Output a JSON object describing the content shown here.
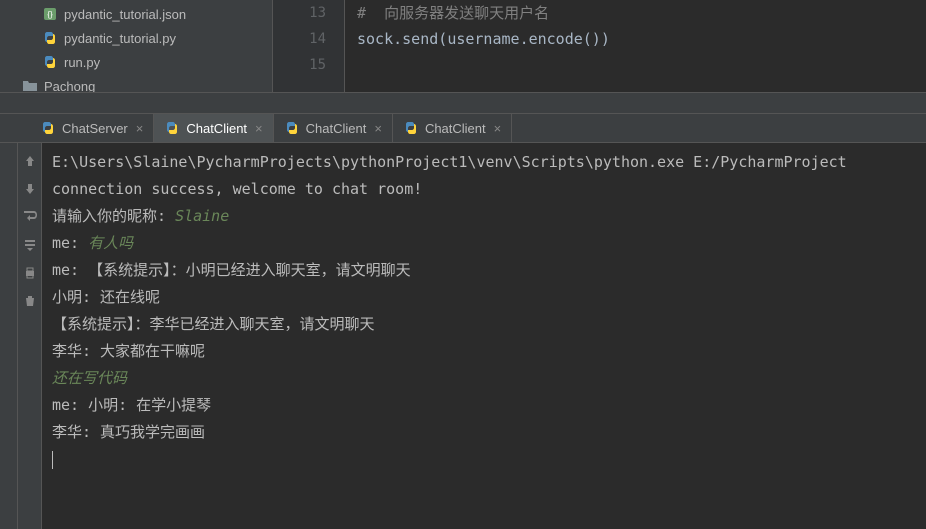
{
  "file_tree": {
    "items": [
      {
        "name": "pydantic_tutorial.json",
        "type": "json"
      },
      {
        "name": "pydantic_tutorial.py",
        "type": "py"
      },
      {
        "name": "run.py",
        "type": "py"
      },
      {
        "name": "Pachong",
        "type": "folder"
      }
    ]
  },
  "editor": {
    "lines": [
      "13",
      "14",
      "15"
    ],
    "code": {
      "comment": "#  向服务器发送聊天用户名",
      "line2_p1": "sock",
      "line2_p2": ".",
      "line2_p3": "send",
      "line2_p4": "(",
      "line2_p5": "username",
      "line2_p6": ".",
      "line2_p7": "encode",
      "line2_p8": "())"
    }
  },
  "tabs": [
    {
      "label": "ChatServer",
      "active": false
    },
    {
      "label": "ChatClient",
      "active": true
    },
    {
      "label": "ChatClient",
      "active": false
    },
    {
      "label": "ChatClient",
      "active": false
    }
  ],
  "console": {
    "lines": [
      {
        "segs": [
          {
            "t": "E:\\Users\\Slaine\\PycharmProjects\\pythonProject1\\venv\\Scripts\\python.exe E:/PycharmProject",
            "c": "c-white"
          }
        ]
      },
      {
        "segs": [
          {
            "t": "connection success, welcome to chat room!",
            "c": "c-white"
          }
        ]
      },
      {
        "segs": [
          {
            "t": "请输入你的昵称: ",
            "c": "c-white"
          },
          {
            "t": "Slaine",
            "c": "c-green"
          }
        ]
      },
      {
        "segs": [
          {
            "t": "me: ",
            "c": "c-white"
          },
          {
            "t": "有人吗",
            "c": "c-green"
          }
        ]
      },
      {
        "segs": [
          {
            "t": "me: 【系统提示】：小明已经进入聊天室，请文明聊天",
            "c": "c-white"
          }
        ]
      },
      {
        "segs": [
          {
            "t": "小明: 还在线呢",
            "c": "c-white"
          }
        ]
      },
      {
        "segs": [
          {
            "t": "【系统提示】：李华已经进入聊天室，请文明聊天",
            "c": "c-white"
          }
        ]
      },
      {
        "segs": [
          {
            "t": "李华: 大家都在干嘛呢",
            "c": "c-white"
          }
        ]
      },
      {
        "segs": [
          {
            "t": "还在写代码",
            "c": "c-green"
          }
        ]
      },
      {
        "segs": [
          {
            "t": "me: 小明: 在学小提琴",
            "c": "c-white"
          }
        ]
      },
      {
        "segs": [
          {
            "t": "李华: 真巧我学完画画",
            "c": "c-white"
          }
        ]
      }
    ]
  }
}
